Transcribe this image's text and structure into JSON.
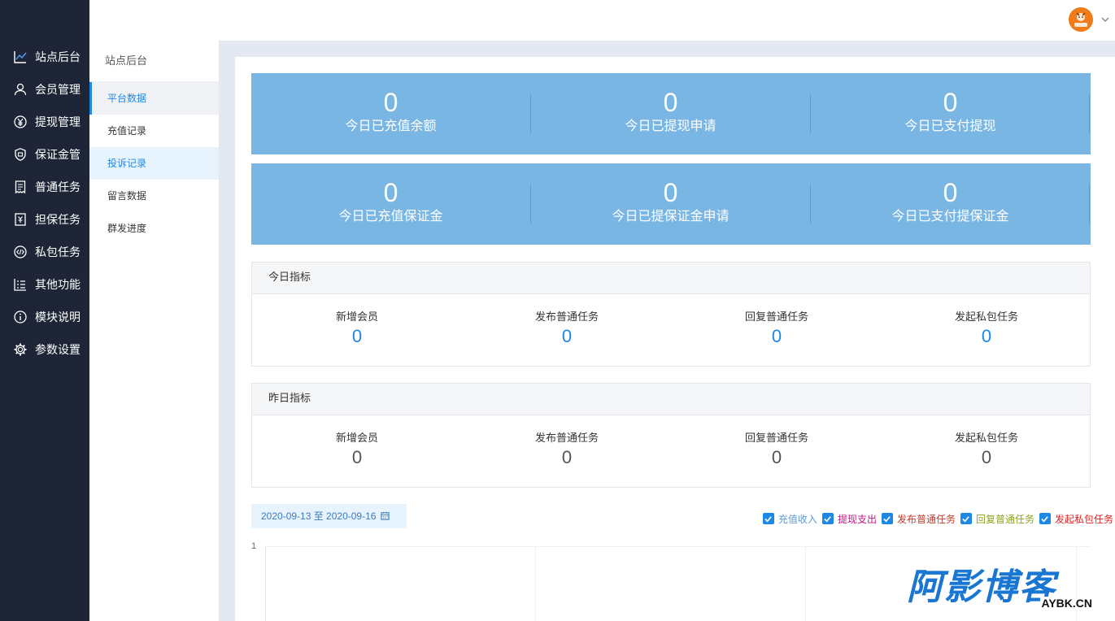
{
  "nav": {
    "items": [
      {
        "label": "站点后台",
        "icon": "line-chart-icon"
      },
      {
        "label": "会员管理",
        "icon": "user-icon"
      },
      {
        "label": "提现管理",
        "icon": "yen-icon"
      },
      {
        "label": "保证金管",
        "icon": "shield-icon"
      },
      {
        "label": "普通任务",
        "icon": "receipt-icon"
      },
      {
        "label": "担保任务",
        "icon": "bill-icon"
      },
      {
        "label": "私包任务",
        "icon": "code-icon"
      },
      {
        "label": "其他功能",
        "icon": "list-icon"
      },
      {
        "label": "模块说明",
        "icon": "info-icon"
      },
      {
        "label": "参数设置",
        "icon": "gear-icon"
      }
    ]
  },
  "submenu": {
    "title": "站点后台",
    "items": [
      "平台数据",
      "充值记录",
      "投诉记录",
      "留言数据",
      "群发进度"
    ]
  },
  "stats_row1": [
    {
      "value": "0",
      "label": "今日已充值余额"
    },
    {
      "value": "0",
      "label": "今日已提现申请"
    },
    {
      "value": "0",
      "label": "今日已支付提现"
    }
  ],
  "stats_row2": [
    {
      "value": "0",
      "label": "今日已充值保证金"
    },
    {
      "value": "0",
      "label": "今日已提保证金申请"
    },
    {
      "value": "0",
      "label": "今日已支付提保证金"
    }
  ],
  "today": {
    "title": "今日指标",
    "metrics": [
      {
        "label": "新增会员",
        "value": "0"
      },
      {
        "label": "发布普通任务",
        "value": "0"
      },
      {
        "label": "回复普通任务",
        "value": "0"
      },
      {
        "label": "发起私包任务",
        "value": "0"
      }
    ]
  },
  "yesterday": {
    "title": "昨日指标",
    "metrics": [
      {
        "label": "新增会员",
        "value": "0"
      },
      {
        "label": "发布普通任务",
        "value": "0"
      },
      {
        "label": "回复普通任务",
        "value": "0"
      },
      {
        "label": "发起私包任务",
        "value": "0"
      }
    ]
  },
  "chart": {
    "date_range": "2020-09-13 至 2020-09-16",
    "legend": [
      {
        "label": "充值收入",
        "color": "#5b9bd5"
      },
      {
        "label": "提现支出",
        "color": "#c71585"
      },
      {
        "label": "发布普通任务",
        "color": "#c0392b"
      },
      {
        "label": "回复普通任务",
        "color": "#8fa31e"
      },
      {
        "label": "发起私包任务",
        "color": "#e02020"
      }
    ],
    "y_tick": "1"
  },
  "colors": {
    "nav_bg": "#1e2537",
    "stat_bg": "#7ab6e4",
    "accent": "#1e88e5"
  },
  "watermark": {
    "main": "阿影博客",
    "sub": "AYBK.CN"
  }
}
